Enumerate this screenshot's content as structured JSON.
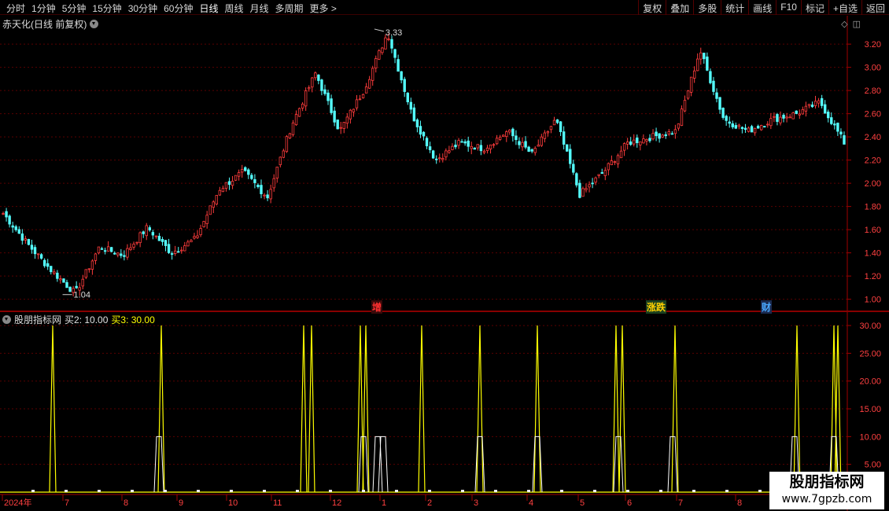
{
  "toolbar": {
    "periods": [
      "分时",
      "1分钟",
      "5分钟",
      "15分钟",
      "30分钟",
      "60分钟",
      "日线",
      "周线",
      "月线",
      "多周期",
      "更多 >"
    ],
    "active_period": "日线",
    "right_buttons": [
      "复权",
      "叠加",
      "多股",
      "统计",
      "画线",
      "F10",
      "标记",
      "+自选",
      "返回"
    ]
  },
  "main_panel": {
    "title": "赤天化(日线 前复权)",
    "high_label": "3.33",
    "low_label": "1.04",
    "y_ticks": [
      "3.20",
      "3.00",
      "2.80",
      "2.60",
      "2.40",
      "2.20",
      "2.00",
      "1.80",
      "1.60",
      "1.40",
      "1.20",
      "1.00"
    ],
    "events": [
      {
        "text": "增",
        "color": "#ff3030"
      },
      {
        "text": "涨跌",
        "color": "#ffd000"
      },
      {
        "text": "财",
        "color": "#4aa8ff"
      }
    ]
  },
  "indicator_panel": {
    "title": "股朋指标网",
    "series_labels": [
      {
        "text": "买2: 10.00",
        "color": "#e0e0e0"
      },
      {
        "text": "买3: 30.00",
        "color": "#ffff00"
      }
    ],
    "y_ticks": [
      "30.00",
      "25.00",
      "20.00",
      "15.00",
      "10.00",
      "5.00"
    ]
  },
  "x_axis": {
    "labels": [
      "2024年",
      "7",
      "8",
      "9",
      "10",
      "11",
      "12",
      "1",
      "2",
      "3",
      "4",
      "5",
      "6",
      "7",
      "8"
    ]
  },
  "watermark": {
    "line1": "股朋指标网",
    "line2": "www.7gpzb.com"
  },
  "colors": {
    "up": "#ff3c3c",
    "down": "#54ffff",
    "grid": "#5a0000",
    "axis": "#a00000",
    "buy2": "#ffffff",
    "buy3": "#ffff00"
  },
  "chart_data": [
    {
      "type": "candlestick",
      "title": "赤天化(日线 前复权)",
      "ylim": [
        0.95,
        3.35
      ],
      "annotations": [
        {
          "text": "3.33",
          "value": 3.33
        },
        {
          "text": "1.04",
          "value": 1.04
        }
      ],
      "close_path": [
        {
          "x": "2024-06",
          "y": 1.74
        },
        {
          "x": "2024-06",
          "y": 1.48
        },
        {
          "x": "2024-07",
          "y": 1.25
        },
        {
          "x": "2024-07",
          "y": 1.05
        },
        {
          "x": "2024-07",
          "y": 1.45
        },
        {
          "x": "2024-08",
          "y": 1.38
        },
        {
          "x": "2024-08",
          "y": 1.62
        },
        {
          "x": "2024-09",
          "y": 1.4
        },
        {
          "x": "2024-09",
          "y": 1.52
        },
        {
          "x": "2024-09",
          "y": 1.95
        },
        {
          "x": "2024-10",
          "y": 2.1
        },
        {
          "x": "2024-10",
          "y": 1.88
        },
        {
          "x": "2024-10",
          "y": 2.5
        },
        {
          "x": "2024-11",
          "y": 2.95
        },
        {
          "x": "2024-11",
          "y": 2.45
        },
        {
          "x": "2024-11",
          "y": 2.8
        },
        {
          "x": "2024-12",
          "y": 3.3
        },
        {
          "x": "2024-12",
          "y": 2.6
        },
        {
          "x": "2024-12",
          "y": 2.2
        },
        {
          "x": "2025-01",
          "y": 2.35
        },
        {
          "x": "2025-02",
          "y": 2.3
        },
        {
          "x": "2025-02",
          "y": 2.45
        },
        {
          "x": "2025-03",
          "y": 2.25
        },
        {
          "x": "2025-03",
          "y": 2.55
        },
        {
          "x": "2025-04",
          "y": 1.9
        },
        {
          "x": "2025-04",
          "y": 2.1
        },
        {
          "x": "2025-05",
          "y": 2.35
        },
        {
          "x": "2025-05",
          "y": 2.4
        },
        {
          "x": "2025-06",
          "y": 2.45
        },
        {
          "x": "2025-06",
          "y": 3.15
        },
        {
          "x": "2025-07",
          "y": 2.55
        },
        {
          "x": "2025-07",
          "y": 2.45
        },
        {
          "x": "2025-08",
          "y": 2.55
        },
        {
          "x": "2025-08",
          "y": 2.6
        },
        {
          "x": "2025-08",
          "y": 2.7
        },
        {
          "x": "2025-09",
          "y": 2.35
        }
      ]
    },
    {
      "type": "line",
      "title": "股朋指标网",
      "ylim": [
        0,
        31
      ],
      "series": [
        {
          "name": "买2",
          "value": 10.0
        },
        {
          "name": "买3",
          "value": 30.0
        }
      ],
      "spike_months": [
        "2024-07",
        "2024-08",
        "2024-11",
        "2024-12",
        "2024-12",
        "2025-02",
        "2025-03",
        "2025-04",
        "2025-06",
        "2025-07",
        "2025-09",
        "2025-09"
      ]
    }
  ]
}
